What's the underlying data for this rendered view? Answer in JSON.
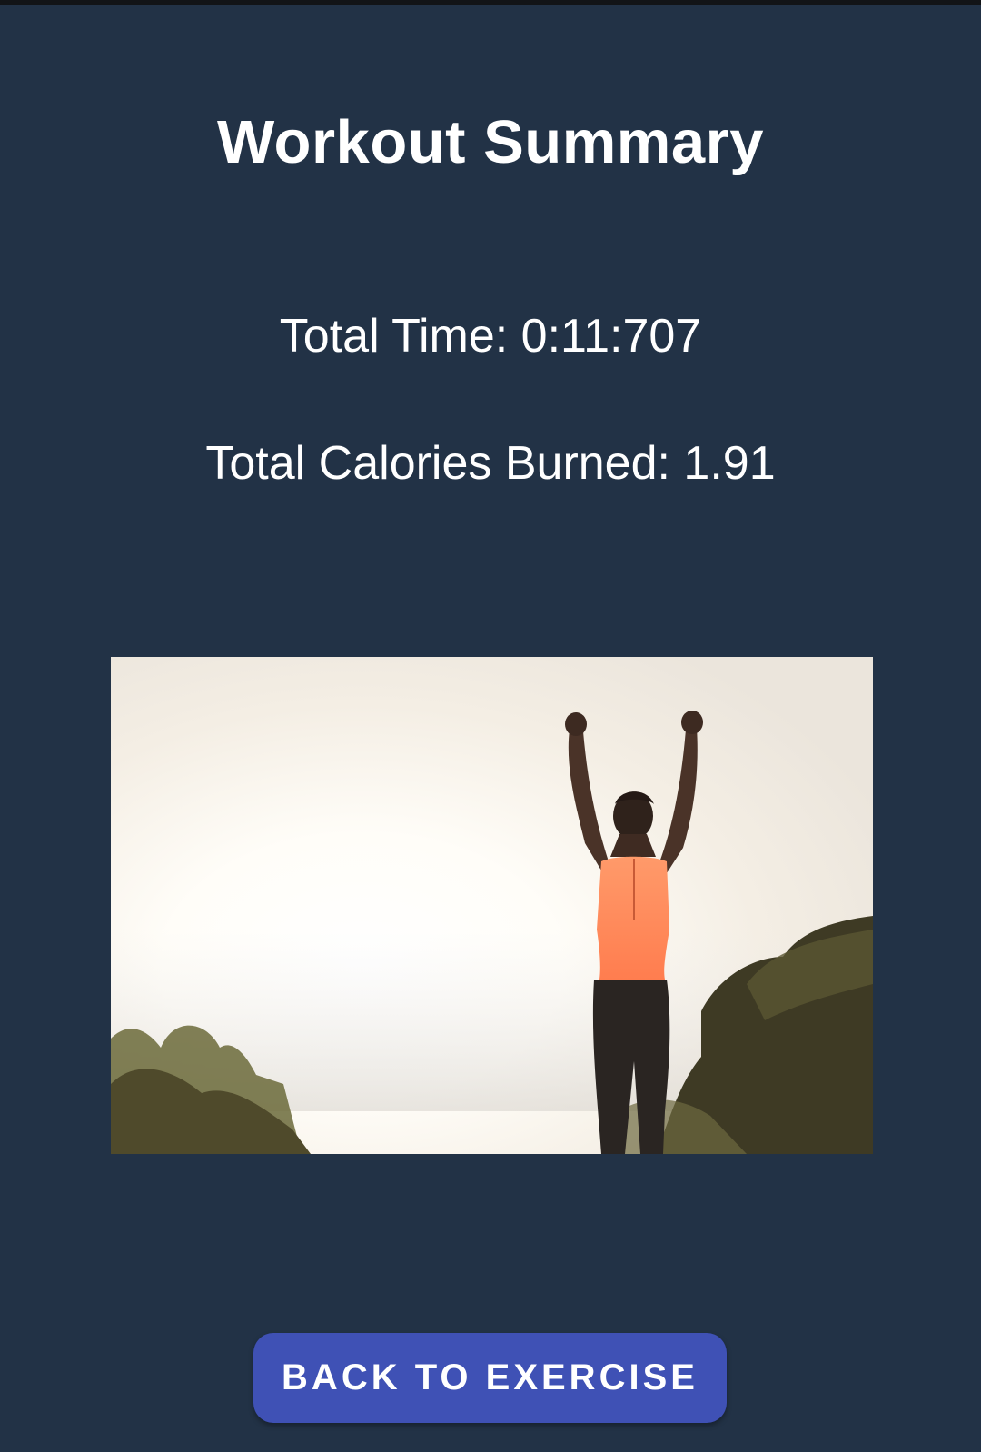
{
  "summary": {
    "title": "Workout Summary",
    "total_time": "Total Time: 0:11:707",
    "total_calories": "Total Calories Burned: 1.91"
  },
  "image": {
    "alt": "Woman with raised arms at sunrise"
  },
  "actions": {
    "back_label": "BACK TO EXERCISE"
  },
  "colors": {
    "background": "#223246",
    "button": "#3f51b5",
    "text": "#ffffff"
  }
}
